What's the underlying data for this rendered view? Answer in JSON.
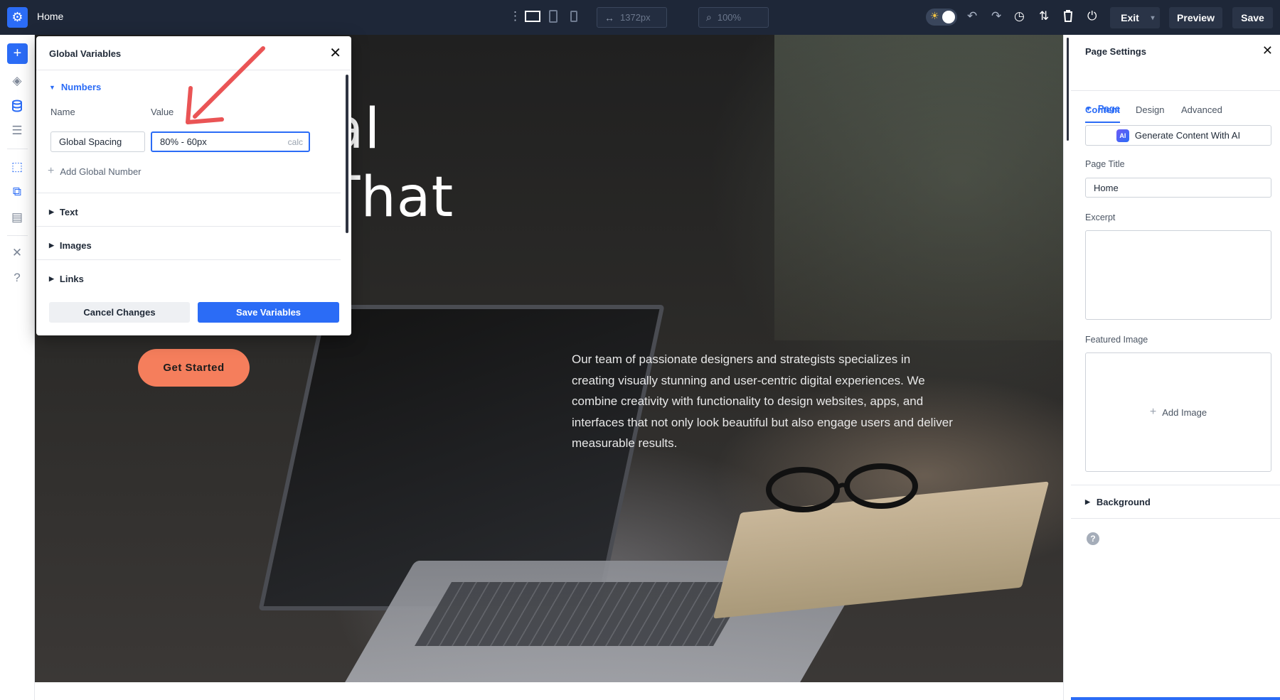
{
  "topbar": {
    "page_name": "Home",
    "width_value": "1372px",
    "zoom_value": "100%",
    "exit_label": "Exit",
    "preview_label": "Preview",
    "save_label": "Save"
  },
  "hero": {
    "title": "g Digital\nences That\nate",
    "body": "Our team of passionate designers and strategists specializes in creating visually stunning and user-centric digital experiences. We combine creativity with functionality to design websites, apps, and interfaces that not only look beautiful but also engage users and deliver measurable results.",
    "cta_label": "Get Started"
  },
  "global_variables": {
    "title": "Global Variables",
    "sections": {
      "numbers": "Numbers",
      "text": "Text",
      "images": "Images",
      "links": "Links"
    },
    "columns": {
      "name": "Name",
      "value": "Value"
    },
    "variable": {
      "name": "Global Spacing",
      "value": "80% - 60px",
      "unit": "calc"
    },
    "add_label": "Add Global Number",
    "cancel_label": "Cancel Changes",
    "save_label": "Save Variables"
  },
  "page_settings": {
    "title": "Page Settings",
    "tabs": [
      "Content",
      "Design",
      "Advanced"
    ],
    "page_section": "Page",
    "ai_badge": "AI",
    "ai_button": "Generate Content With AI",
    "page_title_label": "Page Title",
    "page_title_value": "Home",
    "excerpt_label": "Excerpt",
    "featured_image_label": "Featured Image",
    "add_image_label": "Add Image",
    "background_section": "Background"
  },
  "colors": {
    "topbar_bg": "#1e2738",
    "accent_blue": "#2b6cf6",
    "cta_orange": "#f57e5c",
    "annotation_arrow": "#ea5455"
  }
}
